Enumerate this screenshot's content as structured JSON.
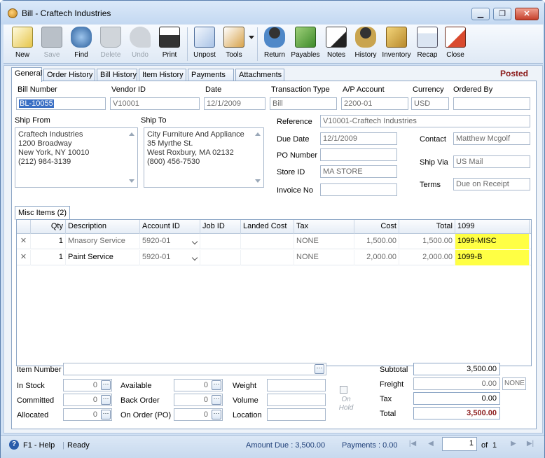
{
  "window": {
    "title": "Bill - Craftech Industries",
    "minimize": "▁",
    "maximize": "❐",
    "close": "✕"
  },
  "toolbar": {
    "items": [
      {
        "label": "New",
        "icon": "new-icon"
      },
      {
        "label": "Save",
        "icon": "save-icon"
      },
      {
        "label": "Find",
        "icon": "find-icon"
      },
      {
        "label": "Delete",
        "icon": "delete-icon"
      },
      {
        "label": "Undo",
        "icon": "undo-icon"
      },
      {
        "label": "Print",
        "icon": "print-icon"
      },
      {
        "label": "Unpost",
        "icon": "unpost-icon"
      },
      {
        "label": "Tools",
        "icon": "tools-icon"
      },
      {
        "label": "Return",
        "icon": "return-icon"
      },
      {
        "label": "Payables",
        "icon": "payables-icon"
      },
      {
        "label": "Notes",
        "icon": "notes-icon"
      },
      {
        "label": "History",
        "icon": "history-icon"
      },
      {
        "label": "Inventory",
        "icon": "inventory-icon"
      },
      {
        "label": "Recap",
        "icon": "recap-icon"
      },
      {
        "label": "Close",
        "icon": "close-doc-icon"
      }
    ]
  },
  "tabs": [
    "General",
    "Order History",
    "Bill History",
    "Item History",
    "Payments",
    "Attachments"
  ],
  "status_badge": "Posted",
  "header": {
    "bill_number_label": "Bill Number",
    "bill_number": "BL-10055",
    "vendor_id_label": "Vendor ID",
    "vendor_id": "V10001",
    "date_label": "Date",
    "date": "12/1/2009",
    "transaction_type_label": "Transaction Type",
    "transaction_type": "Bill",
    "ap_account_label": "A/P Account",
    "ap_account": "2200-01",
    "currency_label": "Currency",
    "currency": "USD",
    "ordered_by_label": "Ordered By",
    "ordered_by": ""
  },
  "ship_from": {
    "label": "Ship From",
    "lines": [
      "Craftech Industries",
      "1200 Broadway",
      "New York, NY 10010",
      "(212) 984-3139"
    ]
  },
  "ship_to": {
    "label": "Ship To",
    "lines": [
      "City Furniture And Appliance",
      "35 Myrthe St.",
      "West Roxbury, MA 02132",
      "(800) 456-7530"
    ]
  },
  "details": {
    "reference_label": "Reference",
    "reference": "V10001-Craftech Industries",
    "due_date_label": "Due Date",
    "due_date": "12/1/2009",
    "po_number_label": "PO Number",
    "po_number": "",
    "store_id_label": "Store ID",
    "store_id": "MA STORE",
    "invoice_no_label": "Invoice No",
    "invoice_no": "",
    "contact_label": "Contact",
    "contact": "Matthew Mcgolf",
    "ship_via_label": "Ship Via",
    "ship_via": "US Mail",
    "terms_label": "Terms",
    "terms": "Due on Receipt"
  },
  "misc_tab": "Misc Items (2)",
  "grid": {
    "columns": [
      "Qty",
      "Description",
      "Account ID",
      "Job ID",
      "Landed Cost",
      "Tax",
      "Cost",
      "Total",
      "1099"
    ],
    "rows": [
      {
        "del": "✕",
        "qty": "1",
        "description": "Mnasory Service",
        "account_id": "5920-01",
        "job_id": "",
        "landed_cost": "",
        "tax": "NONE",
        "cost": "1,500.00",
        "total": "1,500.00",
        "f1099": "1099-MISC"
      },
      {
        "del": "✕",
        "qty": "1",
        "description": "Paint Service",
        "account_id": "5920-01",
        "job_id": "",
        "landed_cost": "",
        "tax": "NONE",
        "cost": "2,000.00",
        "total": "2,000.00",
        "f1099": "1099-B"
      }
    ]
  },
  "item": {
    "item_number_label": "Item Number",
    "item_number": "",
    "in_stock_label": "In Stock",
    "in_stock": "0",
    "committed_label": "Committed",
    "committed": "0",
    "allocated_label": "Allocated",
    "allocated": "0",
    "available_label": "Available",
    "available": "0",
    "back_order_label": "Back Order",
    "back_order": "0",
    "on_order_label": "On Order (PO)",
    "on_order": "0",
    "weight_label": "Weight",
    "weight": "",
    "volume_label": "Volume",
    "volume": "",
    "location_label": "Location",
    "location": "",
    "on_hold": "On Hold",
    "ellipsis": "⋯"
  },
  "totals": {
    "subtotal_label": "Subtotal",
    "subtotal": "3,500.00",
    "freight_label": "Freight",
    "freight": "0.00",
    "freight_tax": "NONE",
    "tax_label": "Tax",
    "tax": "0.00",
    "total_label": "Total",
    "total": "3,500.00"
  },
  "statusbar": {
    "help": "F1 - Help",
    "ready": "Ready",
    "amount_due": "Amount Due : 3,500.00",
    "payments": "Payments : 0.00",
    "page": "1",
    "of": "of",
    "pages": "1",
    "nav_first": "|◀",
    "nav_prev": "◀",
    "nav_next": "▶",
    "nav_last": "▶|"
  },
  "colors": {
    "highlight_1099": "#ffff44",
    "posted": "#8b1a1a",
    "accent": "#3a6fc4"
  }
}
